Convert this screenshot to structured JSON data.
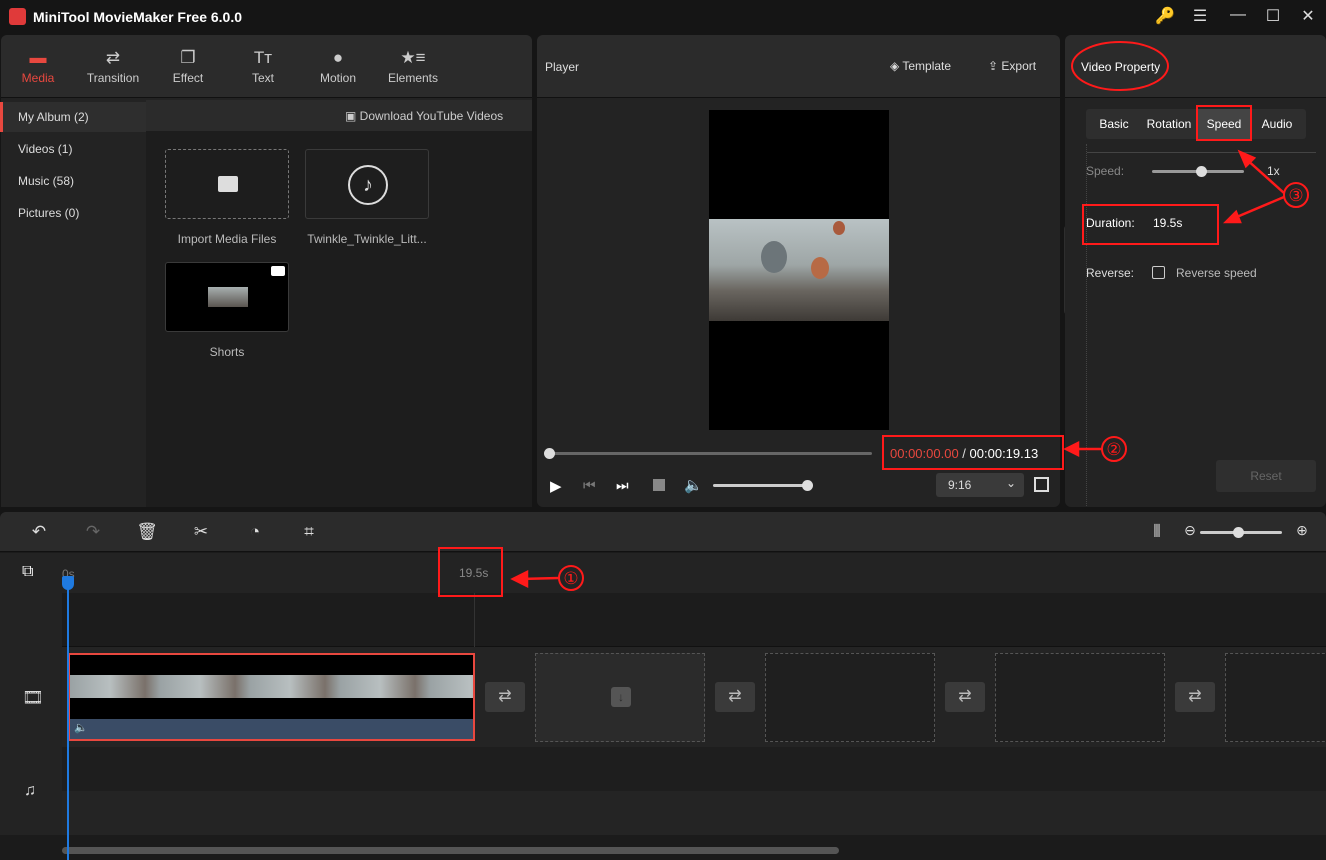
{
  "app": {
    "title": "MiniTool MovieMaker Free 6.0.0"
  },
  "window_controls": [
    {
      "icon": "key-icon",
      "glyph": "🔑"
    },
    {
      "icon": "menu-icon",
      "glyph": "☰"
    },
    {
      "icon": "minimize-icon",
      "glyph": "—"
    },
    {
      "icon": "maximize-icon",
      "glyph": "☐"
    },
    {
      "icon": "close-icon",
      "glyph": "✕"
    }
  ],
  "toolbar": [
    {
      "label": "Media",
      "icon": "folder-icon",
      "glyph": "▬",
      "active": true
    },
    {
      "label": "Transition",
      "icon": "transition-icon",
      "glyph": "⇄"
    },
    {
      "label": "Effect",
      "icon": "effect-icon",
      "glyph": "❐"
    },
    {
      "label": "Text",
      "icon": "text-icon",
      "glyph": "Tт"
    },
    {
      "label": "Motion",
      "icon": "motion-icon",
      "glyph": "●"
    },
    {
      "label": "Elements",
      "icon": "elements-icon",
      "glyph": "★≡"
    }
  ],
  "sidebar": [
    {
      "label": "My Album (2)",
      "active": true
    },
    {
      "label": "Videos (1)"
    },
    {
      "label": "Music (58)"
    },
    {
      "label": "Pictures (0)"
    }
  ],
  "media": {
    "download_label": "Download YouTube Videos",
    "items": [
      {
        "caption": "Import Media Files"
      },
      {
        "caption": "Twinkle_Twinkle_Litt..."
      },
      {
        "caption": "Shorts"
      }
    ]
  },
  "player": {
    "title": "Player",
    "template_label": "Template",
    "export_label": "Export",
    "current_time": "00:00:00.00",
    "separator": " / ",
    "total_time": "00:00:19.13",
    "aspect_ratio": "9:16",
    "progress": 0,
    "volume": 1.0
  },
  "property": {
    "title": "Video Property",
    "tabs": [
      "Basic",
      "Rotation",
      "Speed",
      "Audio"
    ],
    "active_tab": "Speed",
    "speed_label": "Speed:",
    "speed_value": "1x",
    "duration_label": "Duration:",
    "duration_value": "19.5s",
    "reverse_label": "Reverse:",
    "reverse_checkbox_label": "Reverse speed",
    "reverse_checked": false,
    "reset_label": "Reset"
  },
  "timeline": {
    "ruler_start": "0s",
    "ruler_end": "19.5s",
    "zoom_level": 0.5
  },
  "annotations": [
    "①",
    "②",
    "③"
  ],
  "colors": {
    "accent": "#e8483f",
    "annotation": "#ff1a1a",
    "playhead": "#1f7ae0"
  }
}
